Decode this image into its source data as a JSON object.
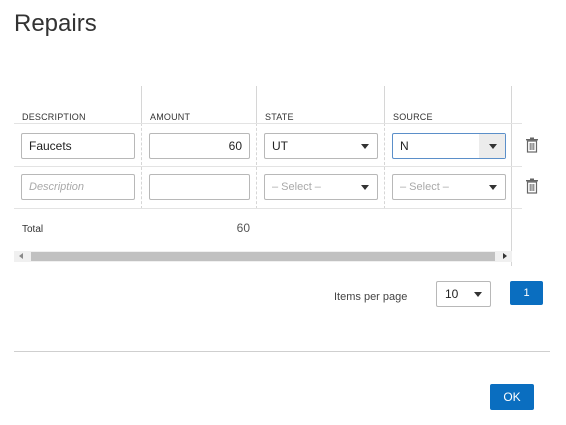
{
  "dialog": {
    "title": "Repairs"
  },
  "grid": {
    "columns": [
      "DESCRIPTION",
      "AMOUNT",
      "STATE",
      "SOURCE"
    ],
    "rows": [
      {
        "description": "Faucets",
        "amount": "60",
        "state": "UT",
        "source": "N"
      },
      {
        "description": "",
        "amount": "",
        "state": "– Select –",
        "source": "– Select –"
      }
    ],
    "placeholders": {
      "description": "Description"
    },
    "total_label": "Total",
    "total_value": "60"
  },
  "pager": {
    "items_per_page_label": "Items per page",
    "page_size": "10",
    "current_page": "1"
  },
  "footer": {
    "ok_label": "OK"
  },
  "colors": {
    "accent": "#0a6ec0",
    "border": "#b8b8b8",
    "focus": "#5b8fc9"
  }
}
